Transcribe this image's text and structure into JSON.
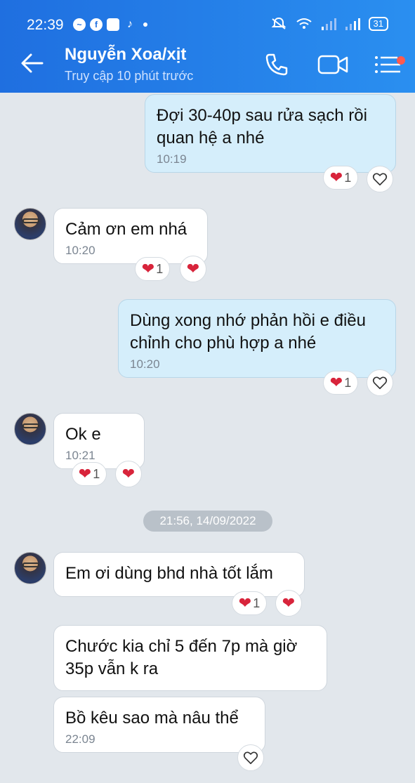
{
  "status_bar": {
    "time": "22:39",
    "battery": "31",
    "app_icons": [
      "messenger-icon",
      "facebook-icon",
      "app-icon",
      "tiktok-icon"
    ],
    "system_icons": [
      "mute-icon",
      "wifi-icon",
      "signal-icon",
      "signal-icon"
    ]
  },
  "header": {
    "title": "Nguyễn Xoa/xịt",
    "subtitle": "Truy cập 10 phút trước",
    "accent_color": "#1f6fe0"
  },
  "messages": [
    {
      "dir": "out",
      "text": "Đợi 30-40p sau rửa sạch rồi quan hệ a nhé",
      "time": "10:19",
      "reaction_count": "1"
    },
    {
      "dir": "in",
      "text": "Cảm ơn em nhá",
      "time": "10:20",
      "reaction_count": "1"
    },
    {
      "dir": "out",
      "text": "Dùng xong nhớ phản hồi e điều chỉnh cho phù hợp a nhé",
      "time": "10:20",
      "reaction_count": "1"
    },
    {
      "dir": "in",
      "text": "Ok e",
      "time": "10:21",
      "reaction_count": "1"
    },
    {
      "dir": "in",
      "text": "Em ơi dùng bhd nhà tốt lắm",
      "time": "",
      "reaction_count": "1"
    },
    {
      "dir": "in",
      "text": "Chước kia chỉ 5 đến 7p mà giờ 35p vẫn k ra",
      "time": ""
    },
    {
      "dir": "in",
      "text": "Bồ kêu sao mà nâu thể",
      "time": "22:09"
    }
  ],
  "date_divider": "21:56, 14/09/2022"
}
